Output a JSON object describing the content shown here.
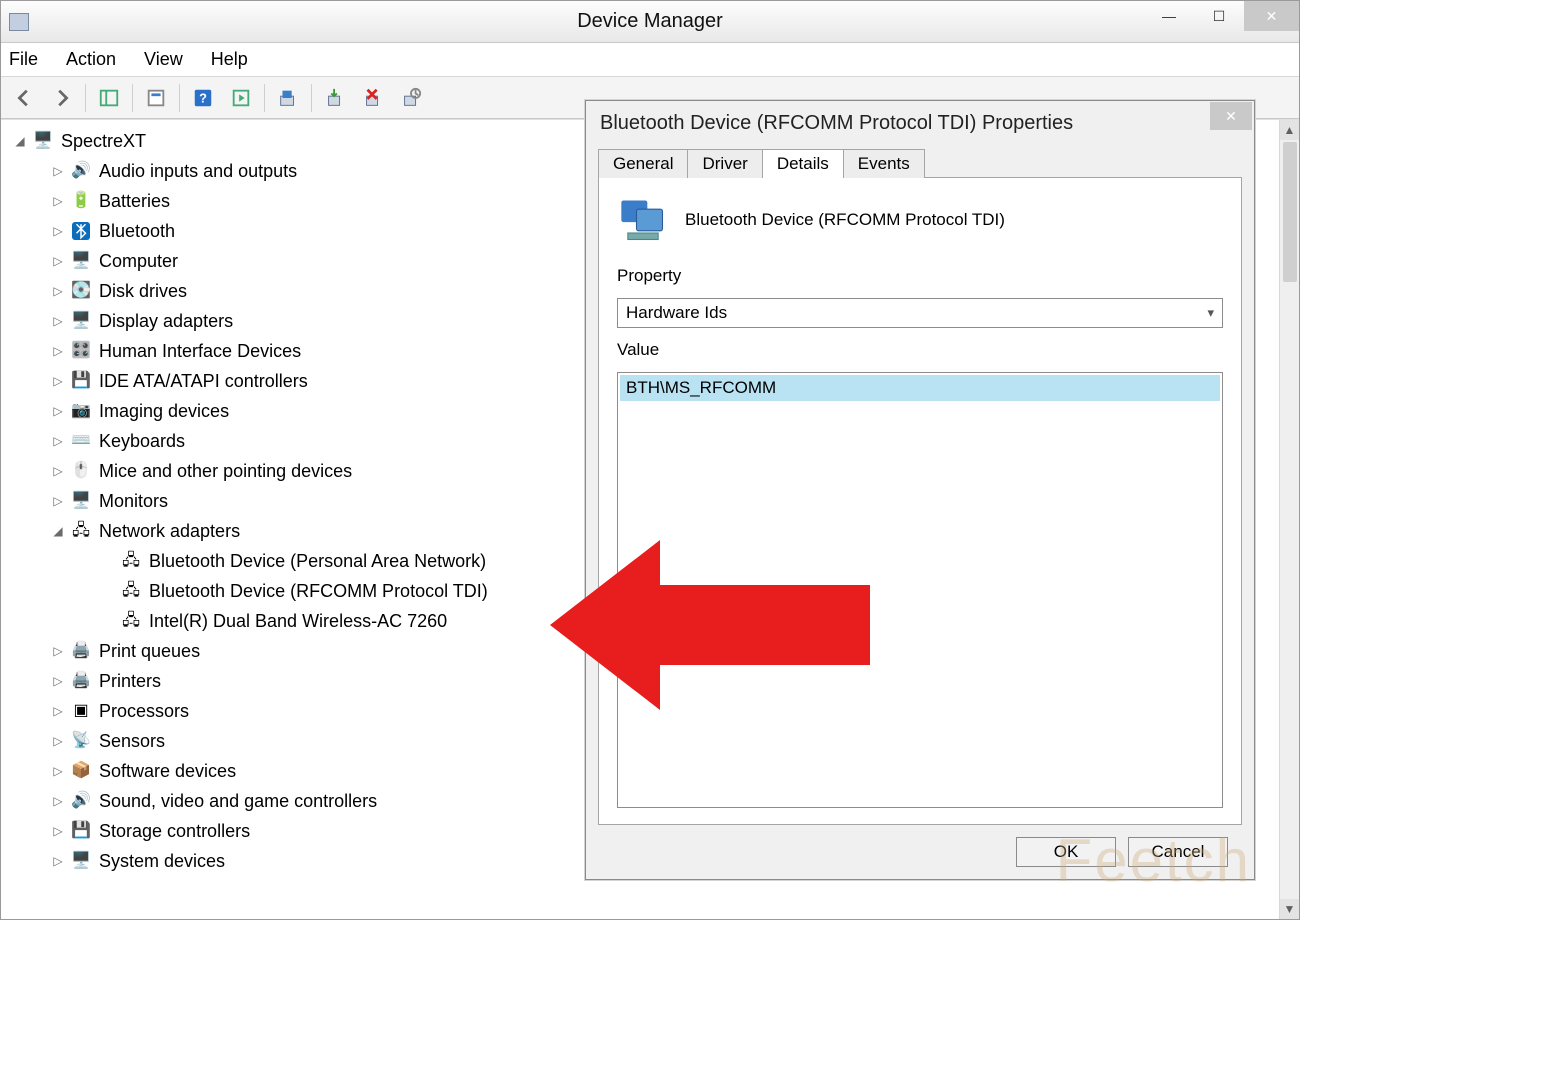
{
  "window": {
    "title": "Device Manager"
  },
  "menu": {
    "file": "File",
    "action": "Action",
    "view": "View",
    "help": "Help"
  },
  "tree": {
    "root": "SpectreXT",
    "items": [
      {
        "label": "Audio inputs and outputs"
      },
      {
        "label": "Batteries"
      },
      {
        "label": "Bluetooth"
      },
      {
        "label": "Computer"
      },
      {
        "label": "Disk drives"
      },
      {
        "label": "Display adapters"
      },
      {
        "label": "Human Interface Devices"
      },
      {
        "label": "IDE ATA/ATAPI controllers"
      },
      {
        "label": "Imaging devices"
      },
      {
        "label": "Keyboards"
      },
      {
        "label": "Mice and other pointing devices"
      },
      {
        "label": "Monitors"
      },
      {
        "label": "Network adapters",
        "expanded": true,
        "children": [
          {
            "label": "Bluetooth Device (Personal Area Network)"
          },
          {
            "label": "Bluetooth Device (RFCOMM Protocol TDI)"
          },
          {
            "label": "Intel(R) Dual Band Wireless-AC 7260"
          }
        ]
      },
      {
        "label": "Print queues"
      },
      {
        "label": "Printers"
      },
      {
        "label": "Processors"
      },
      {
        "label": "Sensors"
      },
      {
        "label": "Software devices"
      },
      {
        "label": "Sound, video and game controllers"
      },
      {
        "label": "Storage controllers"
      },
      {
        "label": "System devices"
      }
    ]
  },
  "dialog": {
    "title": "Bluetooth Device (RFCOMM Protocol TDI) Properties",
    "tabs": {
      "general": "General",
      "driver": "Driver",
      "details": "Details",
      "events": "Events"
    },
    "device_name": "Bluetooth Device (RFCOMM Protocol TDI)",
    "property_label": "Property",
    "property_value": "Hardware Ids",
    "value_label": "Value",
    "value_item": "BTH\\MS_RFCOMM",
    "ok": "OK",
    "cancel": "Cancel"
  },
  "watermark": "Feetch"
}
